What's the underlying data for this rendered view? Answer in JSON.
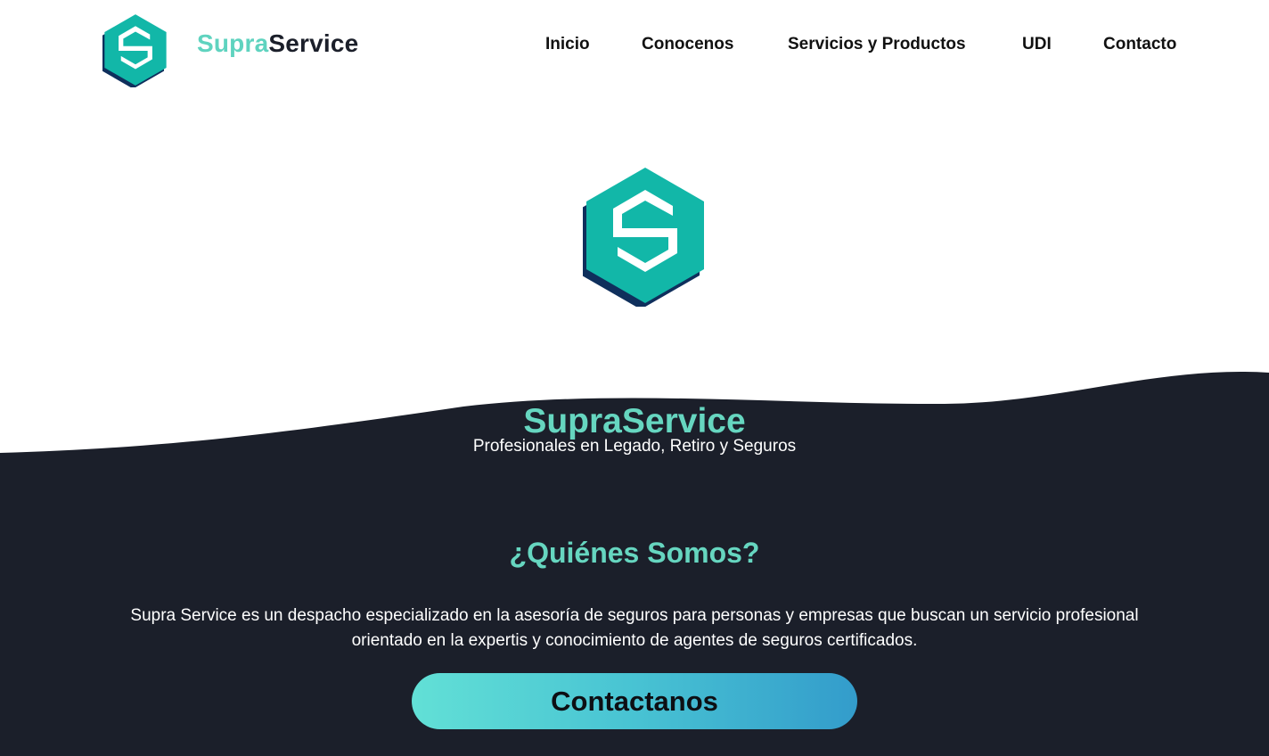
{
  "brand": {
    "name_part1": "Supra",
    "name_part2": "Service",
    "logo_icon": "hexagon-s-logo"
  },
  "nav": {
    "items": [
      {
        "label": "Inicio"
      },
      {
        "label": "Conocenos"
      },
      {
        "label": "Servicios y Productos"
      },
      {
        "label": "UDI"
      },
      {
        "label": "Contacto"
      }
    ]
  },
  "hero": {
    "logo_icon": "hexagon-s-logo",
    "title": "SupraService",
    "subtitle": "Profesionales en Legado, Retiro y Seguros"
  },
  "about": {
    "heading": "¿Quiénes Somos?",
    "line1": "Supra Service es un despacho especializado en la asesoría de seguros para personas y empresas que buscan un servicio profesional",
    "line2": "orientado en la expertis y conocimiento de agentes de seguros certificados.",
    "button_label": "Contactanos"
  },
  "colors": {
    "accent": "#5fd3bf",
    "dark": "#1b1f2a",
    "logo_teal": "#12b7a8",
    "logo_navy": "#0f2f5c"
  }
}
